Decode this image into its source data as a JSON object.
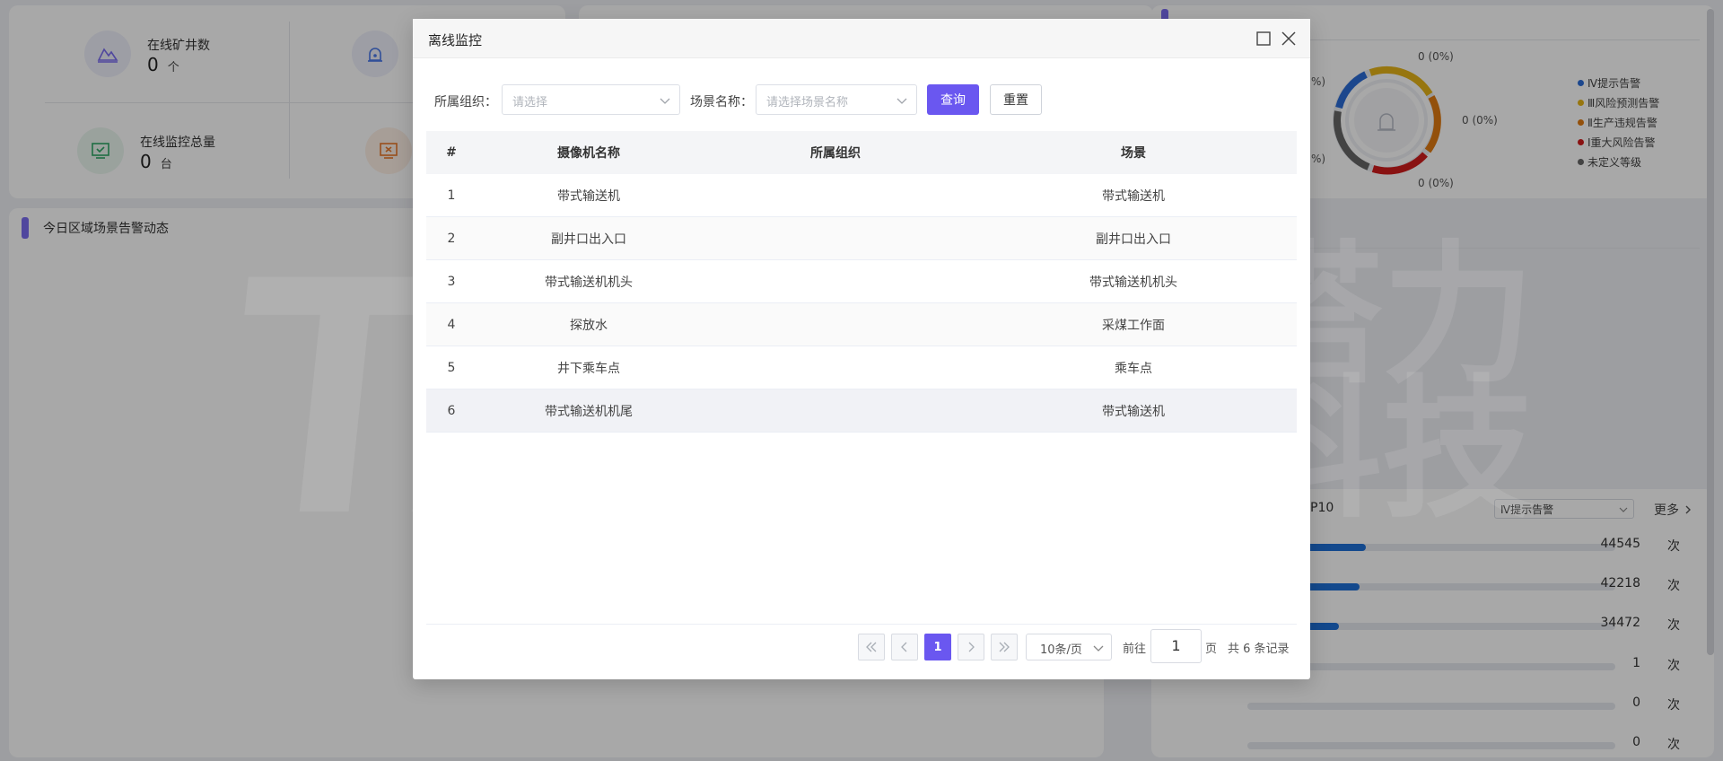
{
  "stats": {
    "online_mines_label": "在线矿井数",
    "online_mines_value": "0",
    "online_mines_unit": "个",
    "online_monitors_label": "在线监控总量",
    "online_monitors_value": "0",
    "online_monitors_unit": "台"
  },
  "region_alert_title": "今日区域场景告警动态",
  "donut": {
    "labels": [
      "0 (0%)",
      "0 (0%)",
      "0 (0%)",
      "%)",
      "%)"
    ]
  },
  "legend": [
    {
      "label": "Ⅳ提示告警",
      "color": "#2b6cd6"
    },
    {
      "label": "Ⅲ风险预测告警",
      "color": "#e6b317"
    },
    {
      "label": "Ⅱ生产违规告警",
      "color": "#e07a12"
    },
    {
      "label": "Ⅰ重大风险告警",
      "color": "#d11c1c"
    },
    {
      "label": "未定义等级",
      "color": "#666666"
    }
  ],
  "top10": {
    "title_fragment": "P10",
    "filter_value": "Ⅳ提示告警",
    "more_label": "更多",
    "rows": [
      {
        "value": "44545",
        "unit": "次",
        "ratio": 1.0
      },
      {
        "value": "42218",
        "unit": "次",
        "ratio": 0.948
      },
      {
        "value": "34472",
        "unit": "次",
        "ratio": 0.774
      },
      {
        "value": "1",
        "unit": "次",
        "ratio": 0
      },
      {
        "value": "0",
        "unit": "次",
        "ratio": 0
      },
      {
        "value": "0",
        "unit": "次",
        "ratio": 0
      }
    ]
  },
  "dialog": {
    "title": "离线监控",
    "org_label": "所属组织：",
    "org_placeholder": "请选择",
    "scene_label": "场景名称：",
    "scene_placeholder": "请选择场景名称",
    "query_label": "查询",
    "reset_label": "重置",
    "columns": [
      "#",
      "摄像机名称",
      "所属组织",
      "场景"
    ],
    "rows": [
      {
        "no": "1",
        "camera": "带式输送机",
        "org": "",
        "scene": "带式输送机"
      },
      {
        "no": "2",
        "camera": "副井口出入口",
        "org": "",
        "scene": "副井口出入口"
      },
      {
        "no": "3",
        "camera": "带式输送机机头",
        "org": "",
        "scene": "带式输送机机头"
      },
      {
        "no": "4",
        "camera": "探放水",
        "org": "",
        "scene": "采煤工作面"
      },
      {
        "no": "5",
        "camera": "井下乘车点",
        "org": "",
        "scene": "乘车点"
      },
      {
        "no": "6",
        "camera": "带式输送机机尾",
        "org": "",
        "scene": "带式输送机"
      }
    ],
    "pager": {
      "current_page": "1",
      "page_size": "10条/页",
      "goto_prefix": "前往",
      "goto_value": "1",
      "goto_suffix": "页",
      "total": "共 6 条记录"
    }
  },
  "watermark": {
    "latin": "TALI",
    "cn_line1": "塔力",
    "cn_line2": "科技"
  }
}
